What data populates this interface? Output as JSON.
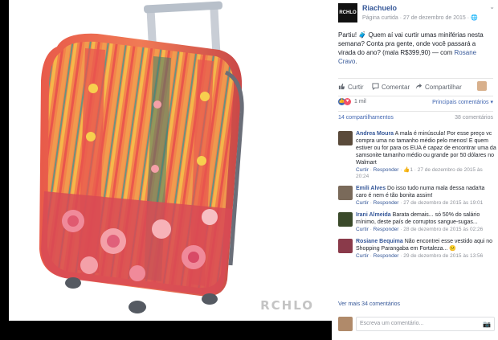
{
  "photo": {
    "watermark": "RCHLO"
  },
  "header": {
    "logo_text": "RCHLO",
    "page_name": "Riachuelo",
    "meta": "Página curtida · 27 de dezembro de 2015 · 🌐",
    "chevron": "⌄"
  },
  "post": {
    "text": "Partiu! 🧳 Quem aí vai curtir umas miniférias nesta semana? Conta pra gente, onde você passará a virada do ano? (mala R$399,90) — com ",
    "tag": "Rosane Cravo",
    "tag_end": "."
  },
  "actions": {
    "like": "Curtir",
    "comment": "Comentar",
    "share": "Compartilhar"
  },
  "reactions": {
    "count": "1 mil",
    "sort": "Principais comentários ▾"
  },
  "stats": {
    "shares": "14 compartilhamentos",
    "comments": "38 comentários"
  },
  "comments": [
    {
      "name": "Andrea Moura",
      "text": "A mala é minúscula! Por esse preço vc compra uma no tamanho médio pelo menos! E quem estiver ou for para os EUA é capaz de encontrar uma da samsonite tamanho médio ou grande por 50 dólares no Walmart",
      "like": "Curtir",
      "reply": "Responder",
      "likes": "1",
      "time": "27 de dezembro de 2015 às 20:24",
      "avatar_color": "#5a4a3a"
    },
    {
      "name": "Emili Alves",
      "text": "Do isso tudo numa mala dessa nada!ta caro é nem é tão bonita assim!",
      "like": "Curtir",
      "reply": "Responder",
      "likes": "",
      "time": "27 de dezembro de 2015 às 19:01",
      "avatar_color": "#7a6a5a"
    },
    {
      "name": "Irani Almeida",
      "text": "Barata demais... só 50% do salário mínimo, deste país de corruptos sangue-sugas...",
      "like": "Curtir",
      "reply": "Responder",
      "likes": "",
      "time": "28 de dezembro de 2015 às 02:26",
      "avatar_color": "#3a4a2a"
    },
    {
      "name": "Rosiane Bequima",
      "text": "Não encontrei esse vestido aqui no Shopping Parangaba em Fortaleza... 😕",
      "like": "Curtir",
      "reply": "Responder",
      "likes": "",
      "time": "29 de dezembro de 2015 às 13:56",
      "avatar_color": "#8a3a4a"
    }
  ],
  "more_comments": "Ver mais 34 comentários",
  "composer": {
    "placeholder": "Escreva um comentário...",
    "camera": "📷"
  }
}
